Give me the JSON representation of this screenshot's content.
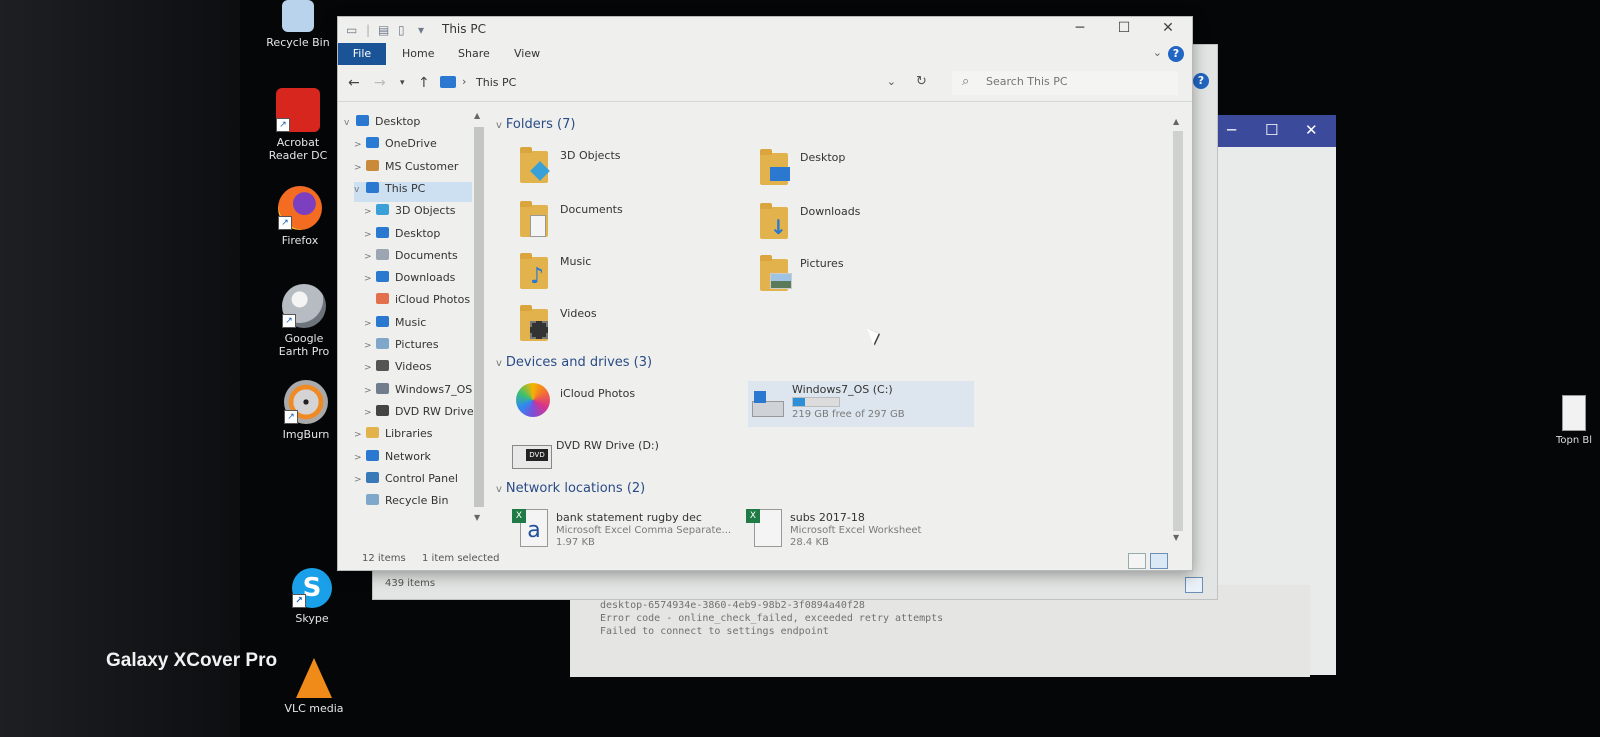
{
  "desktop": {
    "icons": [
      {
        "name": "recycle-bin",
        "label": "Recycle Bin"
      },
      {
        "name": "acrobat",
        "label": "Acrobat Reader DC"
      },
      {
        "name": "firefox",
        "label": "Firefox"
      },
      {
        "name": "google-earth",
        "label": "Google Earth Pro"
      },
      {
        "name": "imgburn",
        "label": "ImgBurn"
      },
      {
        "name": "skype",
        "label": "Skype"
      },
      {
        "name": "vlc",
        "label": "VLC media"
      }
    ],
    "right_edge_label": "Topn Bl"
  },
  "watermark": "Galaxy XCover Pro",
  "background_window": {
    "status": "439 items",
    "error_lines": [
      "desktop-6574934e-3860-4eb9-98b2-3f0894a40f28",
      "Error code - online_check_failed, exceeded retry attempts",
      "Failed to connect to settings endpoint"
    ]
  },
  "explorer": {
    "title": "This PC",
    "ribbon_tabs": [
      "File",
      "Home",
      "Share",
      "View"
    ],
    "address": "This PC",
    "search_placeholder": "Search This PC",
    "nav_tree": [
      {
        "label": "Desktop",
        "level": 0,
        "exp": "v",
        "color": "#2a78d0"
      },
      {
        "label": "OneDrive",
        "level": 1,
        "exp": ">",
        "color": "#2a7bd2"
      },
      {
        "label": "MS Customer",
        "level": 1,
        "exp": ">",
        "color": "#c98a3a"
      },
      {
        "label": "This PC",
        "level": 1,
        "exp": "v",
        "color": "#2a78d0",
        "selected": true
      },
      {
        "label": "3D Objects",
        "level": 2,
        "exp": ">",
        "color": "#3aa0d8"
      },
      {
        "label": "Desktop",
        "level": 2,
        "exp": ">",
        "color": "#2a78d0"
      },
      {
        "label": "Documents",
        "level": 2,
        "exp": ">",
        "color": "#9ca6b3"
      },
      {
        "label": "Downloads",
        "level": 2,
        "exp": ">",
        "color": "#2a78d0"
      },
      {
        "label": "iCloud Photos",
        "level": 2,
        "exp": "",
        "color": "#e2704c"
      },
      {
        "label": "Music",
        "level": 2,
        "exp": ">",
        "color": "#2a78d0"
      },
      {
        "label": "Pictures",
        "level": 2,
        "exp": ">",
        "color": "#7fa7c9"
      },
      {
        "label": "Videos",
        "level": 2,
        "exp": ">",
        "color": "#555"
      },
      {
        "label": "Windows7_OS",
        "level": 2,
        "exp": ">",
        "color": "#6f7d8c"
      },
      {
        "label": "DVD RW Drive",
        "level": 2,
        "exp": ">",
        "color": "#444"
      },
      {
        "label": "Libraries",
        "level": 1,
        "exp": ">",
        "color": "#e2b34d"
      },
      {
        "label": "Network",
        "level": 1,
        "exp": ">",
        "color": "#2a78d0"
      },
      {
        "label": "Control Panel",
        "level": 1,
        "exp": ">",
        "color": "#3a79b8"
      },
      {
        "label": "Recycle Bin",
        "level": 1,
        "exp": "",
        "color": "#7fa7c9"
      }
    ],
    "groups": {
      "folders": "Folders (7)",
      "devices": "Devices and drives (3)",
      "network": "Network locations (2)"
    },
    "folders": [
      "3D Objects",
      "Desktop",
      "Documents",
      "Downloads",
      "Music",
      "Pictures",
      "Videos"
    ],
    "devices": [
      {
        "label": "iCloud Photos"
      },
      {
        "label": "Windows7_OS (C:)",
        "free": "219 GB free of 297 GB",
        "used_fraction": 0.26
      },
      {
        "label": "DVD RW Drive (D:)"
      }
    ],
    "network_items": [
      {
        "label": "bank statement rugby dec",
        "type": "Microsoft Excel Comma Separate...",
        "size": "1.97 KB"
      },
      {
        "label": "subs 2017-18",
        "type": "Microsoft Excel Worksheet",
        "size": "28.4 KB"
      }
    ],
    "status": {
      "count": "12 items",
      "selected": "1 item selected"
    }
  }
}
